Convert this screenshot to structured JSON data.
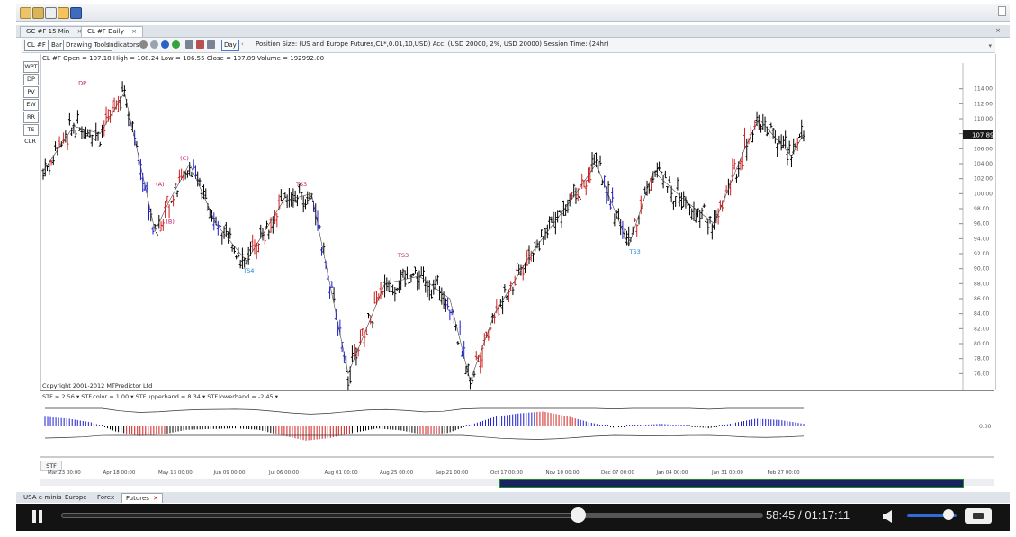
{
  "window": {
    "tabs": [
      {
        "label": "GC #F 15 Min"
      },
      {
        "label": "CL #F Daily",
        "active": true
      }
    ]
  },
  "toolbar": {
    "symbol_label": "CL #F",
    "bar_label": "Bar",
    "drawing_tools_label": "Drawing Tools",
    "indicators_label": "Indicators",
    "period_label": "Day",
    "position_size_text": "Position Size: (US and Europe Futures,CL*,0.01,10,USD) Acc: (USD 20000, 2%, USD 20000) Session Time: (24hr)"
  },
  "side_buttons": [
    "WPT",
    "DP",
    "PV",
    "EW",
    "RR",
    "TS",
    "CLR"
  ],
  "chart_info": "CL #F Open = 107.18  High = 108.24  Low = 106.55  Close = 107.89  Volume = 192992.00",
  "copyright": "Copyright 2001-2012 MTPredictor Ltd",
  "indicator_info": "STF = 2.56 ▾ STF.color = 1.00 ▾ STF.upperband = 8.34 ▾ STF.lowerband = -2.45 ▾",
  "indicator_panel_label": "STF",
  "colors": {
    "up": "#d21e1e",
    "down": "#1d1dd0",
    "neutral": "#000000",
    "annotation_magenta": "#c0186d",
    "annotation_blue": "#1b7fd6"
  },
  "chart_data": {
    "type": "candlestick",
    "y_axis_ticks": [
      76,
      78,
      80,
      82,
      84,
      86,
      88,
      90,
      92,
      94,
      96,
      98,
      100,
      102,
      104,
      106,
      108,
      110,
      112,
      114
    ],
    "y_axis_tick_labels": [
      "76.00",
      "78.00",
      "80.00",
      "82.00",
      "84.00",
      "86.00",
      "88.00",
      "90.00",
      "92.00",
      "94.00",
      "96.00",
      "98.00",
      "100.00",
      "102.00",
      "104.00",
      "106.00",
      "108.00",
      "110.00",
      "112.00",
      "114.00"
    ],
    "ylim": [
      74,
      116
    ],
    "last_price_label": "107.89",
    "x_axis_dates": [
      "Mar 23 00:00",
      "Apr 18 00:00",
      "May 13 00:00",
      "Jun 09 00:00",
      "Jul 06 00:00",
      "Aug 01 00:00",
      "Aug 25 00:00",
      "Sep 21 00:00",
      "Oct 17 00:00",
      "Nov 10 00:00",
      "Dec 07 00:00",
      "Jan 04 00:00",
      "Jan 31 00:00",
      "Feb 27 00:00"
    ],
    "price_path": [
      {
        "bar": 0,
        "price": 103
      },
      {
        "bar": 15,
        "price": 109
      },
      {
        "bar": 28,
        "price": 108
      },
      {
        "bar": 40,
        "price": 113.5
      },
      {
        "bar": 55,
        "price": 95
      },
      {
        "bar": 62,
        "price": 99
      },
      {
        "bar": 72,
        "price": 104
      },
      {
        "bar": 85,
        "price": 96
      },
      {
        "bar": 100,
        "price": 91
      },
      {
        "bar": 118,
        "price": 99
      },
      {
        "bar": 132,
        "price": 100
      },
      {
        "bar": 150,
        "price": 76
      },
      {
        "bar": 168,
        "price": 88
      },
      {
        "bar": 185,
        "price": 89
      },
      {
        "bar": 200,
        "price": 86
      },
      {
        "bar": 210,
        "price": 75
      },
      {
        "bar": 222,
        "price": 84
      },
      {
        "bar": 240,
        "price": 92
      },
      {
        "bar": 262,
        "price": 100
      },
      {
        "bar": 272,
        "price": 104
      },
      {
        "bar": 288,
        "price": 93
      },
      {
        "bar": 300,
        "price": 103
      },
      {
        "bar": 316,
        "price": 99
      },
      {
        "bar": 330,
        "price": 96
      },
      {
        "bar": 345,
        "price": 106
      },
      {
        "bar": 352,
        "price": 110
      },
      {
        "bar": 368,
        "price": 105
      },
      {
        "bar": 374,
        "price": 108
      }
    ],
    "stf_values": [
      1.5,
      1.2,
      0.6,
      -0.8,
      -1.5,
      -1.2,
      -0.5,
      -0.4,
      -0.3,
      -0.5,
      -1.4,
      -2.2,
      -1.8,
      -1.0,
      -0.3,
      -0.6,
      -1.3,
      -1.0,
      0.3,
      1.5,
      2.0,
      2.3,
      1.6,
      0.6,
      -0.2,
      0.2,
      0.4,
      0.1,
      -0.3,
      0.5,
      1.2,
      1.0,
      0.4
    ],
    "stf_upperband": 8.34,
    "stf_lowerband": -2.45,
    "stf_tick_label": "0.00"
  },
  "annotations": [
    {
      "label": "DP",
      "bar": 20,
      "price": 114.5,
      "color": "magenta"
    },
    {
      "label": "(A)",
      "bar": 58,
      "price": 101,
      "color": "magenta"
    },
    {
      "label": "(B)",
      "bar": 63,
      "price": 96,
      "color": "magenta"
    },
    {
      "label": "(C)",
      "bar": 70,
      "price": 104.5,
      "color": "magenta"
    },
    {
      "label": "TS3",
      "bar": 127,
      "price": 101,
      "color": "magenta"
    },
    {
      "label": "TS4",
      "bar": 101,
      "price": 89.5,
      "color": "blue"
    },
    {
      "label": "TS3",
      "bar": 177,
      "price": 91.5,
      "color": "magenta"
    },
    {
      "label": "TS3",
      "bar": 291,
      "price": 92,
      "color": "blue"
    }
  ],
  "bottom_tabs": [
    {
      "label": "USA e-minis"
    },
    {
      "label": "Europe"
    },
    {
      "label": "Forex"
    },
    {
      "label": "Futures",
      "active": true
    }
  ],
  "player": {
    "elapsed": "58:45",
    "separator": "/",
    "duration": "01:17:11",
    "progress": 0.76,
    "volume": 0.8
  }
}
